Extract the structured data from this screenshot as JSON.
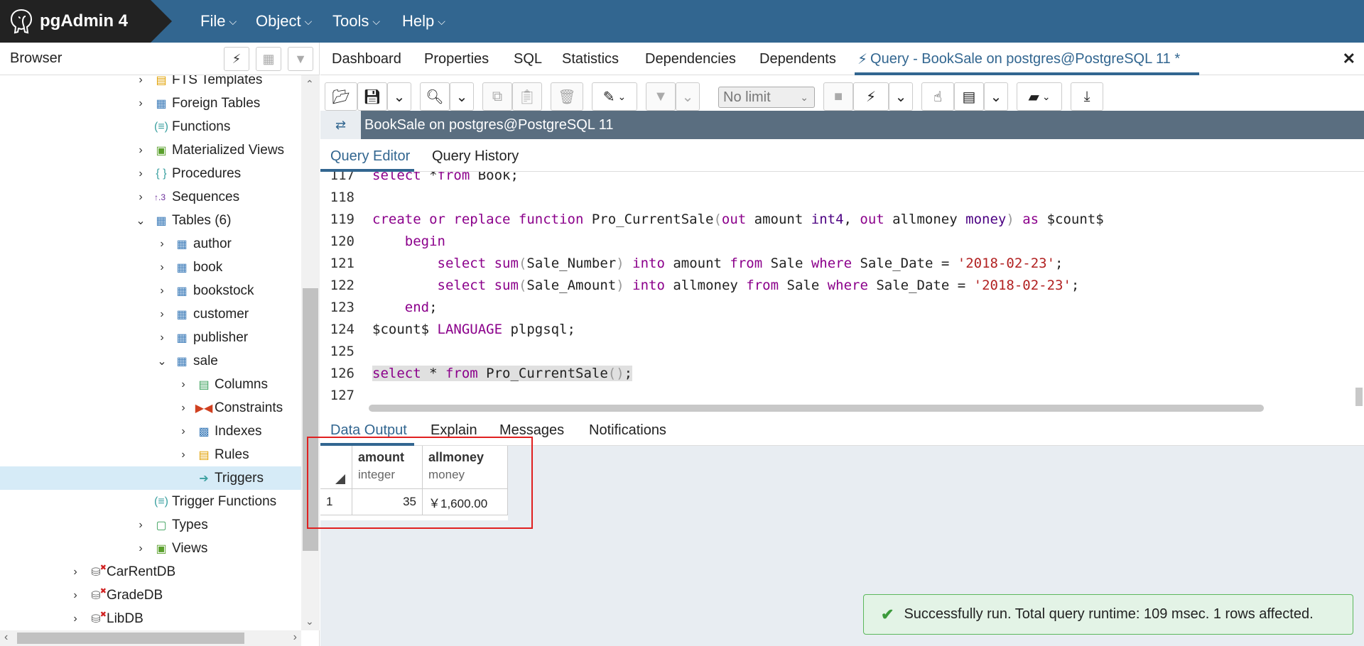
{
  "app": {
    "title": "pgAdmin 4",
    "menus": [
      "File",
      "Object",
      "Tools",
      "Help"
    ]
  },
  "browser": {
    "title": "Browser",
    "tree": [
      {
        "label": "FTS Templates",
        "icon": "fts-templates-icon"
      },
      {
        "label": "Foreign Tables",
        "icon": "foreign-tables-icon"
      },
      {
        "label": "Functions",
        "icon": "functions-icon"
      },
      {
        "label": "Materialized Views",
        "icon": "materialized-views-icon"
      },
      {
        "label": "Procedures",
        "icon": "procedures-icon"
      },
      {
        "label": "Sequences",
        "icon": "sequences-icon"
      },
      {
        "label": "Tables (6)",
        "icon": "tables-icon"
      },
      {
        "label": "author",
        "icon": "table-icon"
      },
      {
        "label": "book",
        "icon": "table-icon"
      },
      {
        "label": "bookstock",
        "icon": "table-icon"
      },
      {
        "label": "customer",
        "icon": "table-icon"
      },
      {
        "label": "publisher",
        "icon": "table-icon"
      },
      {
        "label": "sale",
        "icon": "table-icon"
      },
      {
        "label": "Columns",
        "icon": "columns-icon"
      },
      {
        "label": "Constraints",
        "icon": "constraints-icon"
      },
      {
        "label": "Indexes",
        "icon": "indexes-icon"
      },
      {
        "label": "Rules",
        "icon": "rules-icon"
      },
      {
        "label": "Triggers",
        "icon": "triggers-icon"
      },
      {
        "label": "Trigger Functions",
        "icon": "trigger-functions-icon"
      },
      {
        "label": "Types",
        "icon": "types-icon"
      },
      {
        "label": "Views",
        "icon": "views-icon"
      },
      {
        "label": "CarRentDB",
        "icon": "database-disconnected-icon"
      },
      {
        "label": "GradeDB",
        "icon": "database-disconnected-icon"
      },
      {
        "label": "LibDB",
        "icon": "database-disconnected-icon"
      }
    ]
  },
  "tabs": [
    "Dashboard",
    "Properties",
    "SQL",
    "Statistics",
    "Dependencies",
    "Dependents",
    "Query - BookSale on postgres@PostgreSQL 11 *"
  ],
  "toolbar": {
    "limit": "No limit"
  },
  "connection": {
    "label": "BookSale on postgres@PostgreSQL 11"
  },
  "query_tabs": [
    "Query Editor",
    "Query History"
  ],
  "editor": {
    "line_numbers": [
      "117",
      "118",
      "119",
      "120",
      "121",
      "122",
      "123",
      "124",
      "125",
      "126",
      "127"
    ]
  },
  "output_tabs": [
    "Data Output",
    "Explain",
    "Messages",
    "Notifications"
  ],
  "result": {
    "columns": [
      {
        "name": "amount",
        "type": "integer"
      },
      {
        "name": "allmoney",
        "type": "money"
      }
    ],
    "rows": [
      {
        "num": "1",
        "amount": "35",
        "allmoney": "￥1,600.00"
      }
    ]
  },
  "status": {
    "message": "Successfully run. Total query runtime: 109 msec. 1 rows affected."
  },
  "colors": {
    "header": "#326690",
    "accent": "#326690",
    "keyword": "#8b008b",
    "string": "#b22222",
    "success": "#5cb85c",
    "highlight_box": "#e02020"
  }
}
